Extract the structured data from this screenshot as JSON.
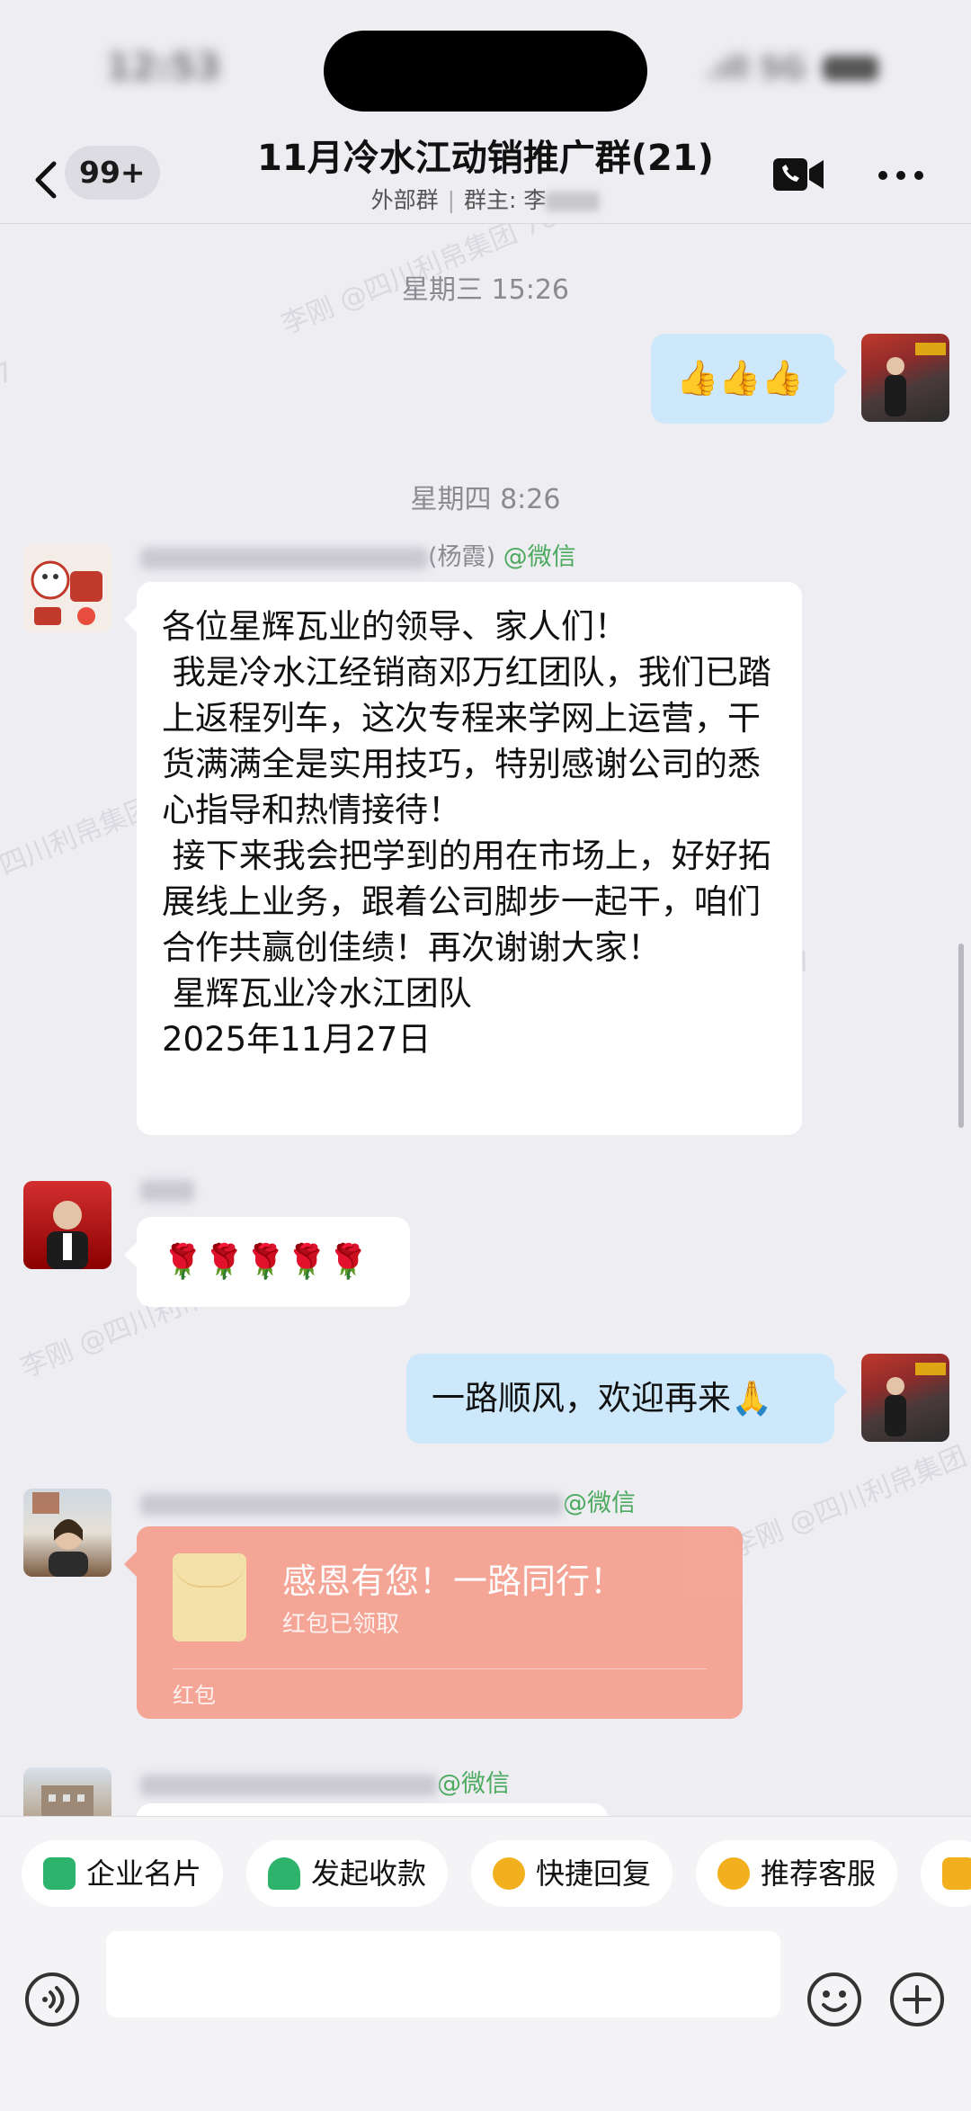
{
  "navbar": {
    "badge": "99+",
    "title": "11月冷水江动销推广群(21)",
    "subtitle_left": "外部群",
    "subtitle_owner_label": "群主:",
    "subtitle_owner_name": "李"
  },
  "watermarks": [
    "李刚 @四川利帛集团 7667",
    "李刚 @四川利帛集团 7667",
    "四川利帛集团 7667",
    "李刚 @四川利帛集团 7667",
    "李刚 @四川利帛集团 7667"
  ],
  "messages": {
    "ts1": "星期三 15:26",
    "out1_text": "👍👍👍",
    "ts2": "星期四 8:26",
    "m1_sender_suffix": "(杨霞)",
    "m1_sender_tag": "@微信",
    "m1_text": "各位星辉瓦业的领导、家人们！\n 我是冷水江经销商邓万红团队，我们已踏上返程列车，这次专程来学网上运营，干货满满全是实用技巧，特别感谢公司的悉心指导和热情接待！\n 接下来我会把学到的用在市场上，好好拓展线上业务，跟着公司脚步一起干，咱们合作共赢创佳绩！再次谢谢大家！\n 星辉瓦业冷水江团队\n2025年11月27日",
    "m2_text": "🌹🌹🌹🌹🌹",
    "out2_text": "一路顺风，欢迎再来🙏",
    "m3_sender_tag": "@微信",
    "m4_sender_tag": "@微信"
  },
  "redpacket": {
    "title": "感恩有您！一路同行！",
    "status": "红包已领取",
    "label": "红包"
  },
  "quickbar": {
    "items": [
      {
        "label": "企业名片",
        "color": "#2db36b"
      },
      {
        "label": "发起收款",
        "color": "#2db36b"
      },
      {
        "label": "快捷回复",
        "color": "#f2b01e"
      },
      {
        "label": "推荐客服",
        "color": "#f2b01e"
      }
    ]
  },
  "colors": {
    "accent_green": "#4caa5f",
    "bubble_out": "#cde8fb",
    "redpacket": "#f59f8f"
  }
}
